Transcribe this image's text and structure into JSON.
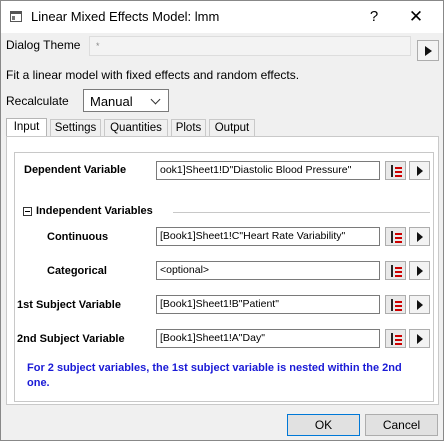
{
  "window": {
    "title": "Linear Mixed Effects Model: lmm",
    "help_glyph": "?",
    "close_glyph": "✕",
    "icon": "app-window-icon"
  },
  "theme": {
    "label": "Dialog Theme",
    "value": "*"
  },
  "description": "Fit a linear model with fixed effects and random effects.",
  "recalculate": {
    "label": "Recalculate",
    "value": "Manual"
  },
  "tabs": [
    {
      "label": "Input",
      "active": true
    },
    {
      "label": "Settings",
      "active": false
    },
    {
      "label": "Quantities",
      "active": false
    },
    {
      "label": "Plots",
      "active": false
    },
    {
      "label": "Output",
      "active": false
    }
  ],
  "input": {
    "dependent": {
      "label": "Dependent Variable",
      "value": "ook1]Sheet1!D\"Diastolic Blood Pressure\""
    },
    "independent_group": {
      "label": "Independent Variables"
    },
    "continuous": {
      "label": "Continuous",
      "value": "[Book1]Sheet1!C\"Heart Rate Variability\""
    },
    "categorical": {
      "label": "Categorical",
      "value": "<optional>"
    },
    "subject1": {
      "label": "1st Subject Variable",
      "value": "[Book1]Sheet1!B\"Patient\""
    },
    "subject2": {
      "label": "2nd Subject Variable",
      "value": "[Book1]Sheet1!A\"Day\""
    },
    "note": "For 2 subject variables, the 1st subject variable is nested within the 2nd one."
  },
  "buttons": {
    "ok": "OK",
    "cancel": "Cancel"
  }
}
